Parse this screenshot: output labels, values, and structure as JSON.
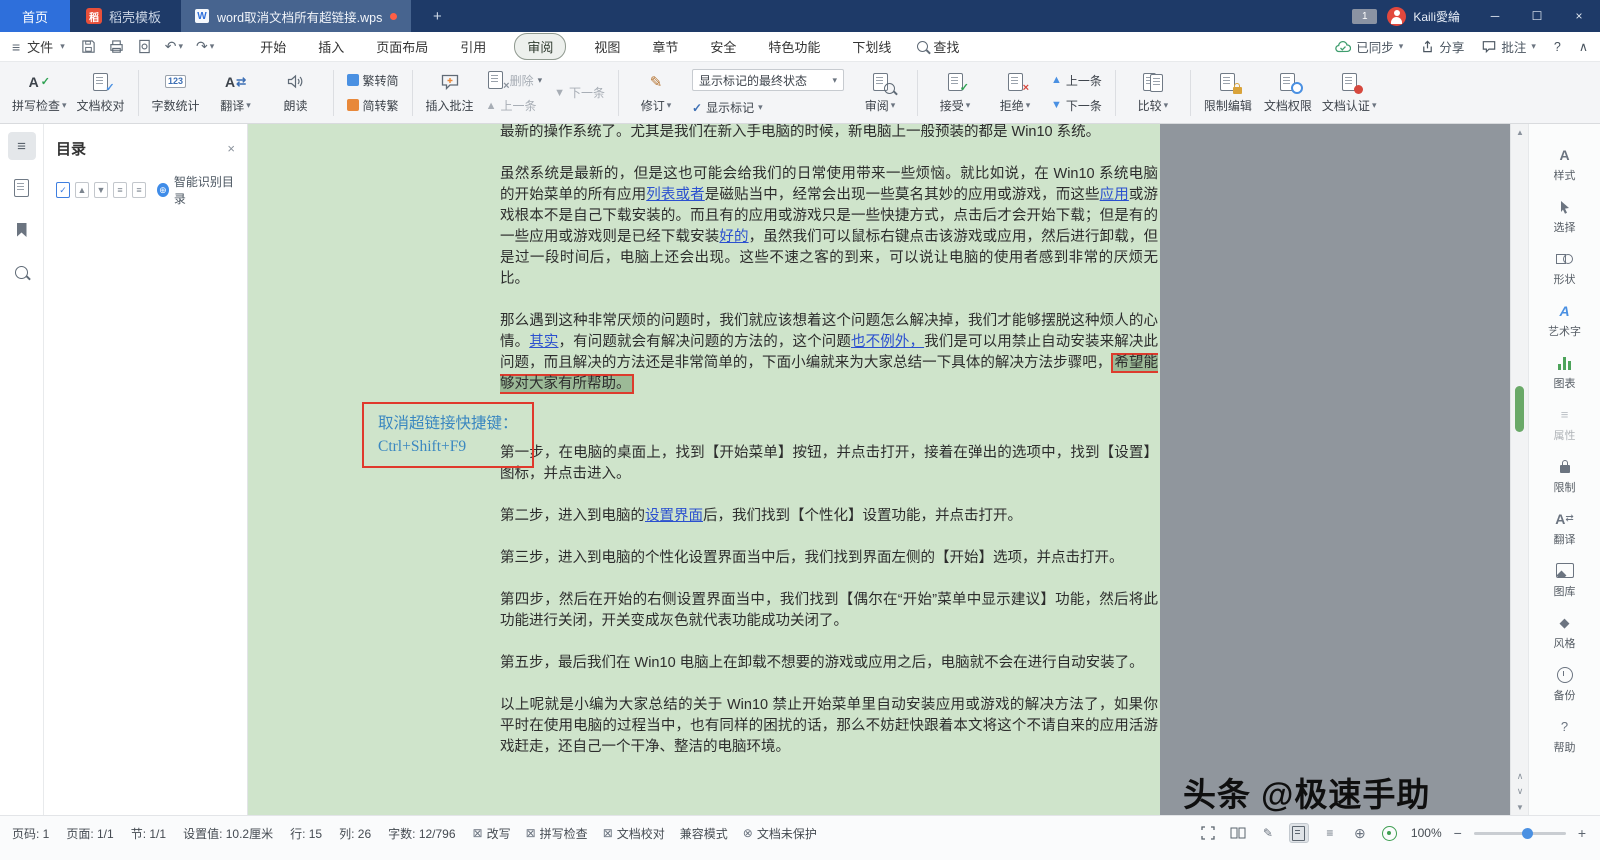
{
  "titlebar": {
    "home": "首页",
    "template_tab": "稻壳模板",
    "document_tab": "word取消文档所有超链接.wps",
    "badge_count": "1",
    "user_name": "Kaili愛綸"
  },
  "menubar": {
    "file": "文件",
    "tabs": [
      "开始",
      "插入",
      "页面布局",
      "引用",
      "审阅",
      "视图",
      "章节",
      "安全",
      "特色功能",
      "下划线"
    ],
    "find": "查找",
    "synced": "已同步",
    "share": "分享",
    "comment": "批注"
  },
  "ribbon": {
    "spellcheck": "拼写检查",
    "proofread": "文档校对",
    "word_count": "字数统计",
    "translate": "翻译",
    "read_aloud": "朗读",
    "trad_to_simp": "繁转简",
    "simp_to_trad": "简转繁",
    "insert_comment": "插入批注",
    "delete": "删除",
    "prev_comment": "上一条",
    "next_comment": "下一条",
    "track_changes": "修订",
    "markup_state": "显示标记的最终状态",
    "show_markup": "显示标记",
    "review": "审阅",
    "accept": "接受",
    "reject": "拒绝",
    "prev_change": "上一条",
    "next_change": "下一条",
    "compare": "比较",
    "restrict_edit": "限制编辑",
    "doc_permission": "文档权限",
    "doc_auth": "文档认证"
  },
  "toc": {
    "title": "目录",
    "smart_label": "智能识别目录"
  },
  "right_panel": {
    "items": [
      "样式",
      "选择",
      "形状",
      "艺术字",
      "图表",
      "属性",
      "限制",
      "翻译",
      "图库",
      "风格",
      "备份",
      "帮助"
    ]
  },
  "document": {
    "paragraphs": [
      {
        "segments": [
          {
            "text": "最新的操作系统了。尤其是我们在新入手电脑的时候，新电脑上一般预装的都是 Win10 系统。"
          }
        ]
      },
      {
        "segments": [
          {
            "text": "虽然系统是最新的，但是这也可能会给我们的日常使用带来一些烦恼。就比如说，在 Win10 系统电脑的开始菜单的所有应用"
          },
          {
            "text": "列表或者",
            "link": true
          },
          {
            "text": "是磁贴当中，经常会出现一些莫名其妙的应用或游戏，而这些"
          },
          {
            "text": "应用",
            "link": true
          },
          {
            "text": "或游戏根本不是自己下载安装的。而且有的应用或游戏只是一些快捷方式，点击后才会开始下载；但是有的一些应用或游戏则是已经下载安装"
          },
          {
            "text": "好的",
            "link": true
          },
          {
            "text": "，虽然我们可以鼠标右键点击该游戏或应用，然后进行卸载，但是过一段时间后，电脑上还会出现。这些不速之客的到来，可以说让电脑的使用者感到非常的厌烦无比。"
          }
        ]
      },
      {
        "extra_gap": true,
        "segments": [
          {
            "text": "那么遇到这种非常厌烦的问题时，我们就应该想着这个问题怎么解决掉，我们才能够摆脱这种烦人的心情。"
          },
          {
            "text": "其实",
            "link": true
          },
          {
            "text": "，有问题就会有解决问题的方法的，这个问题"
          },
          {
            "text": "也不例外，",
            "link": true
          },
          {
            "text": "我们是可以用禁止自动安装来解决此问题，而且解决的方法还是非常简单的，下面小编就来为大家总结一下具体的解决方法步骤吧，"
          },
          {
            "text": "希望能够对大家有所帮助。",
            "highlight": true
          }
        ]
      },
      {
        "segments": [
          {
            "text": "第一步，在电脑的桌面上，找到【开始菜单】按钮，并点击打开，接着在弹出的选项中，找到【设置】图标，并点击进入。"
          }
        ]
      },
      {
        "segments": [
          {
            "text": "第二步，进入到电脑的"
          },
          {
            "text": "设置界面",
            "link": true
          },
          {
            "text": "后，我们找到【个性化】设置功能，并点击打开。"
          }
        ]
      },
      {
        "segments": [
          {
            "text": "第三步，进入到电脑的个性化设置界面当中后，我们找到界面左侧的【开始】选项，并点击打开。"
          }
        ]
      },
      {
        "segments": [
          {
            "text": "第四步，然后在开始的右侧设置界面当中，我们找到【偶尔在“开始”菜单中显示建议】功能，然后将此功能进行关闭，开关变成灰色就代表功能成功关闭了。"
          }
        ]
      },
      {
        "segments": [
          {
            "text": "第五步，最后我们在 Win10 电脑上在卸载不想要的游戏或应用之后，电脑就不会在进行自动安装了。"
          }
        ]
      },
      {
        "segments": [
          {
            "text": "以上呢就是小编为大家总结的关于 Win10 禁止开始菜单里自动安装应用或游戏的解决方法了，如果你平时在使用电脑的过程当中，也有同样的困扰的话，那么不妨赶快跟着本文将这个不请自来的应用活游戏赶走，还自己一个干净、整洁的电脑环境。"
          }
        ]
      }
    ],
    "annotation": {
      "line1": "取消超链接快捷键：",
      "line2": "Ctrl+Shift+F9"
    }
  },
  "statusbar": {
    "page_no": "页码: 1",
    "page": "页面: 1/1",
    "section": "节: 1/1",
    "setting": "设置值: 10.2厘米",
    "line": "行: 15",
    "column": "列: 26",
    "words": "字数: 12/796",
    "overwrite": "改写",
    "spellcheck": "拼写检查",
    "proofread": "文档校对",
    "compat": "兼容模式",
    "unprotected": "文档未保护",
    "zoom": "100%"
  },
  "watermark": "头条 @极速手助",
  "icons": {
    "hamburger": "≡",
    "caret_down": "▾",
    "undo": "↶",
    "redo": "↷",
    "plus": "+",
    "minimize": "─",
    "maximize": "☐",
    "close": "×",
    "question": "?",
    "collapse_up": "∧",
    "chevron_up": "∧",
    "chevron_down": "∨",
    "up": "▲",
    "down": "▼",
    "check": "✓",
    "cross": "×",
    "minus": "−",
    "globe": "⊕",
    "pencil": "✎",
    "overwrite_box": "⊠",
    "unprotect_icon": "⊗",
    "letter_a": "A",
    "numbers": "123",
    "docer_logo": "稻",
    "doc_letter": "W",
    "swap": "⇄",
    "diamond": "◆"
  },
  "colors": {
    "title_bar": "#1e3a68",
    "home_button": "#2e6fdb",
    "page_green": "#cfe4cb",
    "canvas_gray": "#90969d",
    "highlight_green": "#9cba97",
    "highlight_border_red": "#dd3b2d",
    "annotation_red": "#e0392c",
    "annotation_text_blue": "#3a87c0",
    "link_blue": "#2b50cf",
    "accept_green": "#2ea152",
    "reject_red": "#d6483e",
    "eye_protection_green": "#3f9e52"
  }
}
